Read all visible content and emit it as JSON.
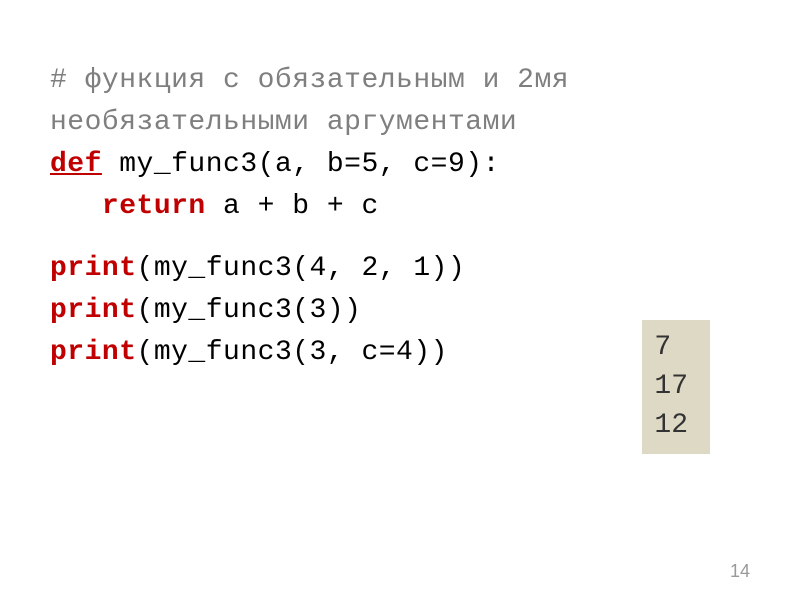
{
  "code": {
    "comment_line1": "# функция с обязательным и 2мя",
    "comment_line2": "необязательными аргументами",
    "def_keyword": "def",
    "def_rest": " my_func3(a, b=5, c=9):",
    "return_keyword": "   return",
    "return_rest": " a + b + c",
    "print1_keyword": "print",
    "print1_rest": "(my_func3(4, 2, 1))",
    "print2_keyword": "print",
    "print2_rest": "(my_func3(3))",
    "print3_keyword": "print",
    "print3_rest": "(my_func3(3, c=4))"
  },
  "output": {
    "line1": "7",
    "line2": "17",
    "line3": "12"
  },
  "page_number": "14"
}
